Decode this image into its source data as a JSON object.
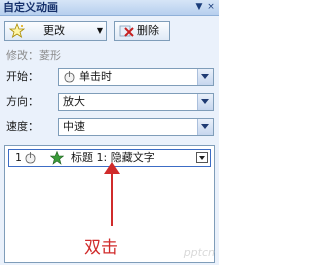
{
  "window": {
    "title": "自定义动画",
    "ctrl_dropdown": "▼",
    "ctrl_close": "×"
  },
  "toolbar": {
    "change_label": "更改",
    "change_icon": "star-sparkle-icon",
    "delete_label": "删除",
    "delete_icon": "delete-x-icon"
  },
  "effect": {
    "modify_label": "修改：菱形"
  },
  "fields": {
    "start_label": "开始：",
    "start_value": "单击时",
    "direction_label": "方向：",
    "direction_value": "放大",
    "speed_label": "速度：",
    "speed_value": "中速"
  },
  "animation_list": [
    {
      "order": "1",
      "name": "标题 1: 隐藏文字"
    }
  ],
  "annotation": {
    "text": "双击",
    "color": "#d02b2b"
  },
  "watermark": {
    "text": "pptcn"
  }
}
